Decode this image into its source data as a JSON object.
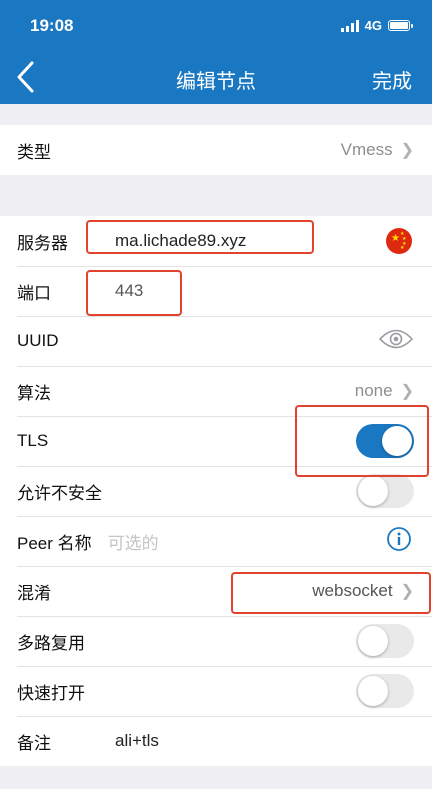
{
  "status_bar": {
    "time": "19:08",
    "network": "4G"
  },
  "nav": {
    "title": "编辑节点",
    "done_label": "完成"
  },
  "type_row": {
    "label": "类型",
    "value": "Vmess"
  },
  "form": {
    "server": {
      "label": "服务器",
      "value": "ma.lichade89.xyz"
    },
    "port": {
      "label": "端口",
      "value": "443"
    },
    "uuid": {
      "label": "UUID"
    },
    "algorithm": {
      "label": "算法",
      "value": "none"
    },
    "tls": {
      "label": "TLS",
      "enabled": true
    },
    "allow_insecure": {
      "label": "允许不安全",
      "enabled": false
    },
    "peer": {
      "label": "Peer 名称",
      "placeholder": "可选的"
    },
    "obfs": {
      "label": "混淆",
      "value": "websocket"
    },
    "mux": {
      "label": "多路复用",
      "enabled": false
    },
    "fast_open": {
      "label": "快速打开",
      "enabled": false
    },
    "remark": {
      "label": "备注",
      "value": "ali+tls"
    }
  },
  "colors": {
    "accent": "#1a78c2",
    "highlight": "#e2432e",
    "background": "#efeff4"
  },
  "icons": [
    "chevron-left-icon",
    "chevron-right-icon",
    "eye-icon",
    "info-icon",
    "china-flag-icon",
    "signal-icon",
    "battery-icon"
  ]
}
